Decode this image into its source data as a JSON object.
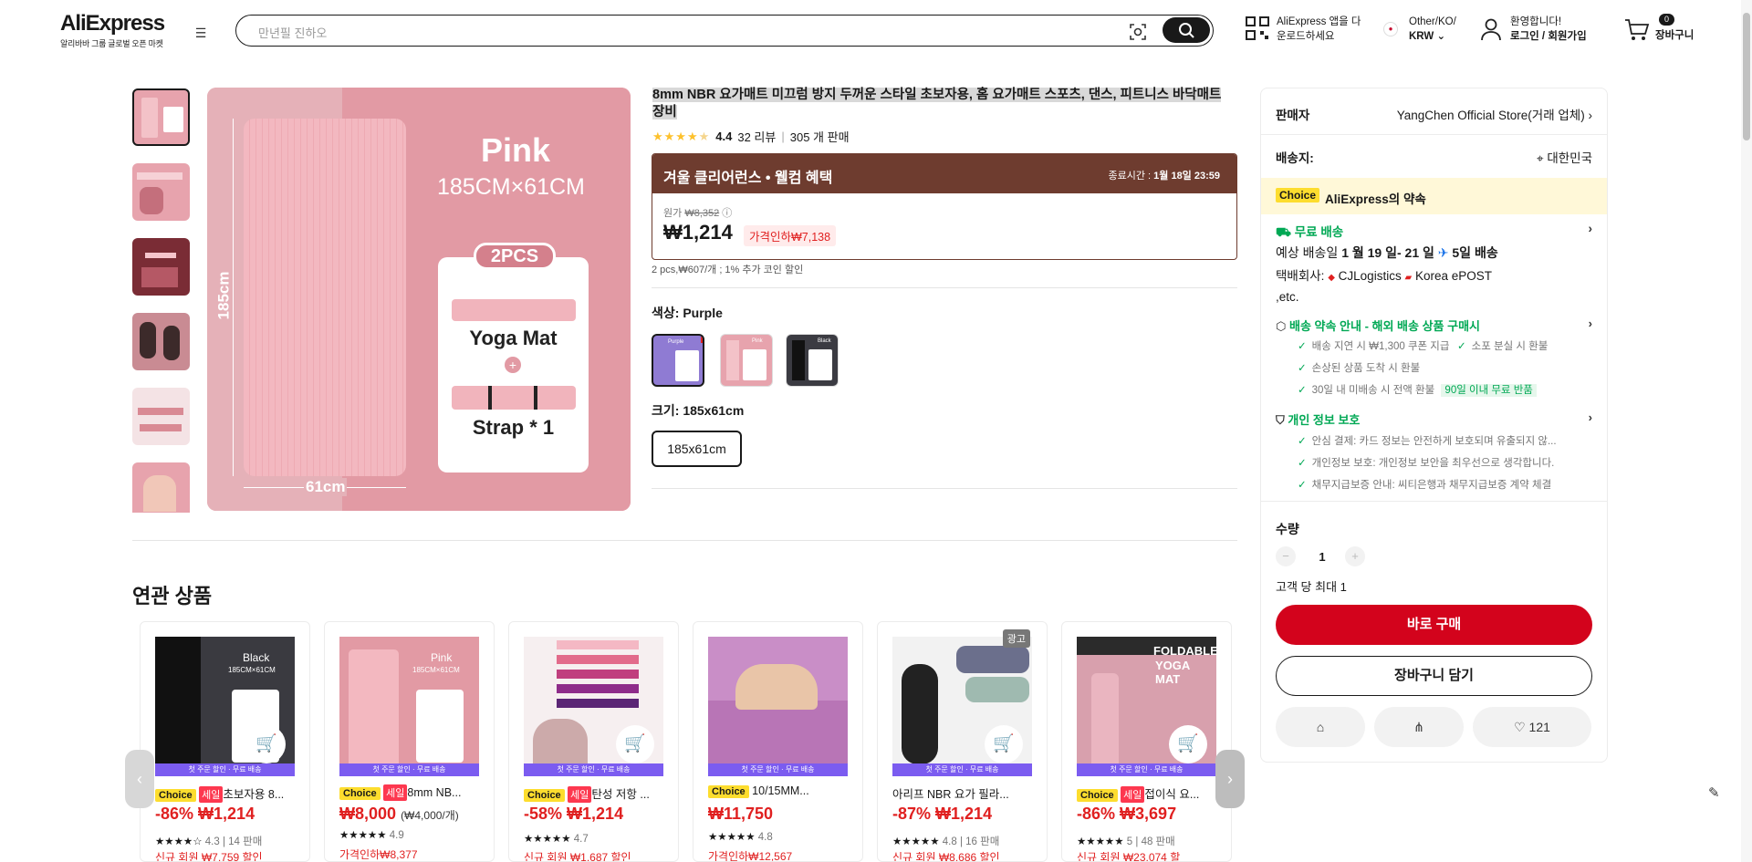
{
  "header": {
    "brand": "AliExpress",
    "tagline": "알리바바 그룹 글로벌 오픈 마켓",
    "search_placeholder": "만년필 진하오",
    "app_line1": "AliExpress 앱을 다",
    "app_line2": "운로드하세요",
    "region_line1": "Other/KO/",
    "region_line2": "KRW",
    "account_line1": "환영합니다!",
    "account_line2": "로그인 / 회원가입",
    "cart_count": "0",
    "cart_label": "장바구니"
  },
  "gallery": {
    "main": {
      "color_word": "Pink",
      "dims": "185CM×61CM",
      "pcs": "2PCS",
      "item1": "Yoga Mat",
      "plus": "+",
      "item2": "Strap * 1",
      "height_label": "185cm",
      "width_label": "61cm"
    }
  },
  "product": {
    "title": "8mm NBR 요가매트 미끄럼 방지 두꺼운 스타일 초보자용, 홈 요가매트 스포츠, 댄스, 피트니스 바닥매트 장비",
    "rating": "4.4",
    "reviews": "32 리뷰",
    "sold": "305 개 판매",
    "promo_title": "겨울 클리어런스 • 웰컴 혜택",
    "end_label": "종료시간 :",
    "end_time": "1월 18일 23:59",
    "orig_label": "원가",
    "orig_price": "₩8,352",
    "price": "₩1,214",
    "discount": "가격인하₩7,138",
    "unit_info": "2 pcs,₩607/개 ; 1% 추가 코인 할인",
    "color_label": "색상:",
    "color_value": "Purple",
    "swatches": [
      {
        "label": "Purple"
      },
      {
        "label": "Pink"
      },
      {
        "label": "Black"
      }
    ],
    "size_label": "크기:",
    "size_value": "185x61cm",
    "size_option": "185x61cm"
  },
  "panel": {
    "seller_label": "판매자",
    "seller_name": "YangChen Official Store(거래 업체)",
    "ship_to_label": "배송지:",
    "ship_to": "대한민국",
    "choice_badge": "Choice",
    "promise": "AliExpress의 약속",
    "free_ship": "무료 배송",
    "eta_prefix": "예상 배송일",
    "eta_dates": "1 월 19 일- 21 일",
    "eta_fast": "5일 배송",
    "carrier_label": "택배회사:",
    "carrier1": "CJLogistics",
    "carrier2": "Korea",
    "carrier3": "ePOST ,etc.",
    "delivery_promise": "배송 약속 안내 - 해외 배송 상품 구매시",
    "chk1": "배송 지연 시 ₩1,300 쿠폰 지급",
    "chk2": "소포 분실 시 환불",
    "chk3": "손상된 상품 도착 시 환불",
    "chk4": "30일 내 미배송 시 전액 환불",
    "return_badge": "90일 이내 무료 반품",
    "privacy": "개인 정보 보호",
    "chk5": "안심 결제: 카드 정보는 안전하게 보호되며 유출되지 않...",
    "chk6": "개인정보 보호: 개인정보 보안을 최우선으로 생각합니다.",
    "chk7": "채무지급보증 안내: 씨티은행과 채무지급보증 계약 체결",
    "qty_label": "수량",
    "qty_value": "1",
    "minus": "−",
    "plus": "+",
    "limit": "고객 당 최대 1",
    "buy_now": "바로 구매",
    "add_cart": "장바구니 담기",
    "wish_count": "121"
  },
  "related": {
    "heading": "연관 상품",
    "band_text": "첫 주문 할인 · 무료 배송",
    "ad_label": "광고",
    "items": [
      {
        "choice": "Choice",
        "sale": "세일",
        "name": "초보자용 8...",
        "off": "-86%",
        "price": "₩1,214",
        "rating": "4.3",
        "sold": "14 판매",
        "promo": "신규 회원 ₩7,759 할인",
        "img_title": "Black",
        "img_sub": "185CM×61CM"
      },
      {
        "choice": "Choice",
        "sale": "세일",
        "name": "8mm NB...",
        "off": "",
        "price": "₩8,000",
        "unit": "(₩4,000/개)",
        "rating": "4.9",
        "sold": "",
        "promo": "가격인하₩8,377",
        "img_title": "Pink",
        "img_sub": "185CM×61CM"
      },
      {
        "choice": "Choice",
        "sale": "세일",
        "name": "탄성 저항 ...",
        "off": "-58%",
        "price": "₩1,214",
        "rating": "4.7",
        "sold": "",
        "promo": "신규 회원 ₩1,687 할인",
        "img_title": "",
        "img_sub": ""
      },
      {
        "choice": "Choice",
        "sale": "",
        "name": "10/15MM...",
        "off": "",
        "price": "₩11,750",
        "rating": "4.8",
        "sold": "",
        "promo": "가격인하₩12,567",
        "img_title": "",
        "img_sub": ""
      },
      {
        "choice": "",
        "sale": "",
        "name": "아리프 NBR 요가 필라...",
        "off": "-87%",
        "price": "₩1,214",
        "rating": "4.8",
        "sold": "16 판매",
        "promo": "신규 회원 ₩8,686 할인",
        "img_title": "",
        "img_sub": ""
      },
      {
        "choice": "Choice",
        "sale": "세일",
        "name": "접이식 요...",
        "off": "-86%",
        "price": "₩3,697",
        "rating": "5",
        "sold": "48 판매",
        "promo": "신규 회원 ₩23,074 할",
        "img_title": "FOLDABLE",
        "img_sub": "YOGA MAT"
      }
    ]
  },
  "colors": {
    "accent_red": "#e02020",
    "buy_red": "#d3031c",
    "promo_brown": "#6e3c2f",
    "choice_yellow": "#fddd2e",
    "green": "#00a854"
  }
}
